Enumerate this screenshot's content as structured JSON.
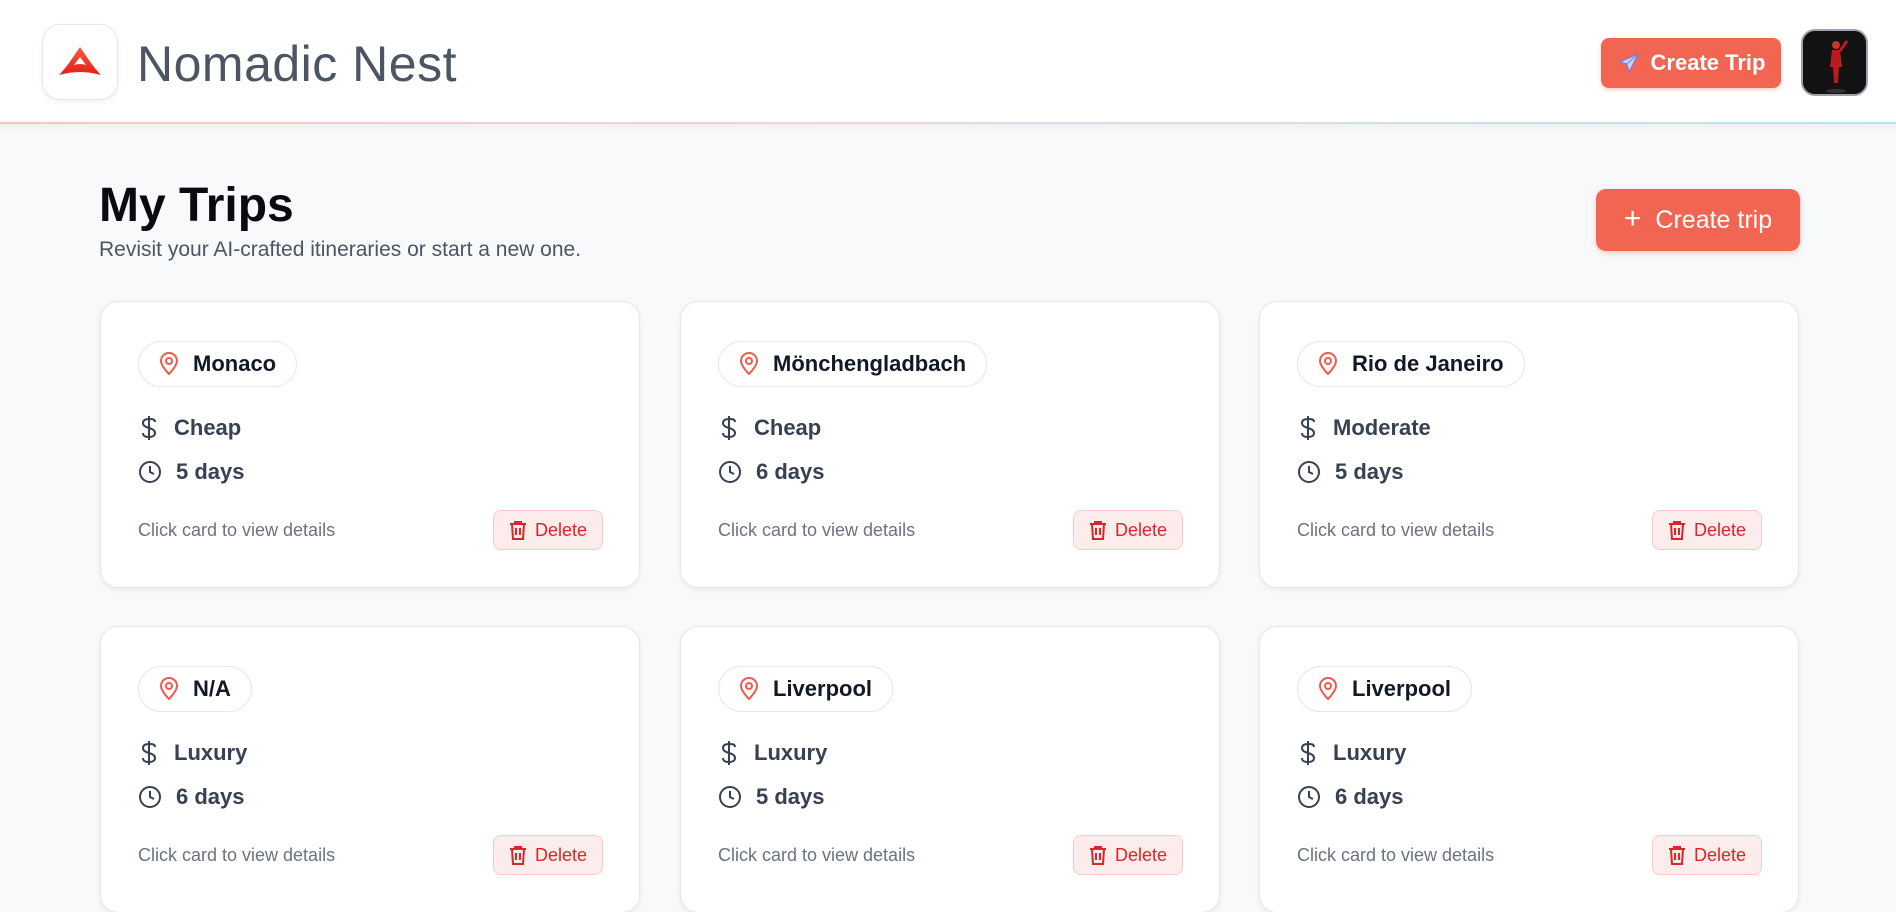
{
  "app": {
    "brand": "Nomadic Nest",
    "accent_color": "#f26552",
    "logo_icon": "mountain-logo-icon"
  },
  "header": {
    "create_trip_label": "Create Trip",
    "create_trip_icon": "airplane-icon",
    "avatar_icon": "user-avatar"
  },
  "page": {
    "title": "My Trips",
    "subtitle": "Revisit your AI-crafted itineraries or start a new one.",
    "create_button_label": "Create trip",
    "create_button_icon": "plus-icon"
  },
  "trips": [
    {
      "location": "Monaco",
      "budget": "Cheap",
      "duration": "5 days",
      "hint": "Click card to view details",
      "delete_label": "Delete"
    },
    {
      "location": "Mönchengladbach",
      "budget": "Cheap",
      "duration": "6 days",
      "hint": "Click card to view details",
      "delete_label": "Delete"
    },
    {
      "location": "Rio de Janeiro",
      "budget": "Moderate",
      "duration": "5 days",
      "hint": "Click card to view details",
      "delete_label": "Delete"
    },
    {
      "location": "N/A",
      "budget": "Luxury",
      "duration": "6 days",
      "hint": "Click card to view details",
      "delete_label": "Delete"
    },
    {
      "location": "Liverpool",
      "budget": "Luxury",
      "duration": "5 days",
      "hint": "Click card to view details",
      "delete_label": "Delete"
    },
    {
      "location": "Liverpool",
      "budget": "Luxury",
      "duration": "6 days",
      "hint": "Click card to view details",
      "delete_label": "Delete"
    }
  ]
}
